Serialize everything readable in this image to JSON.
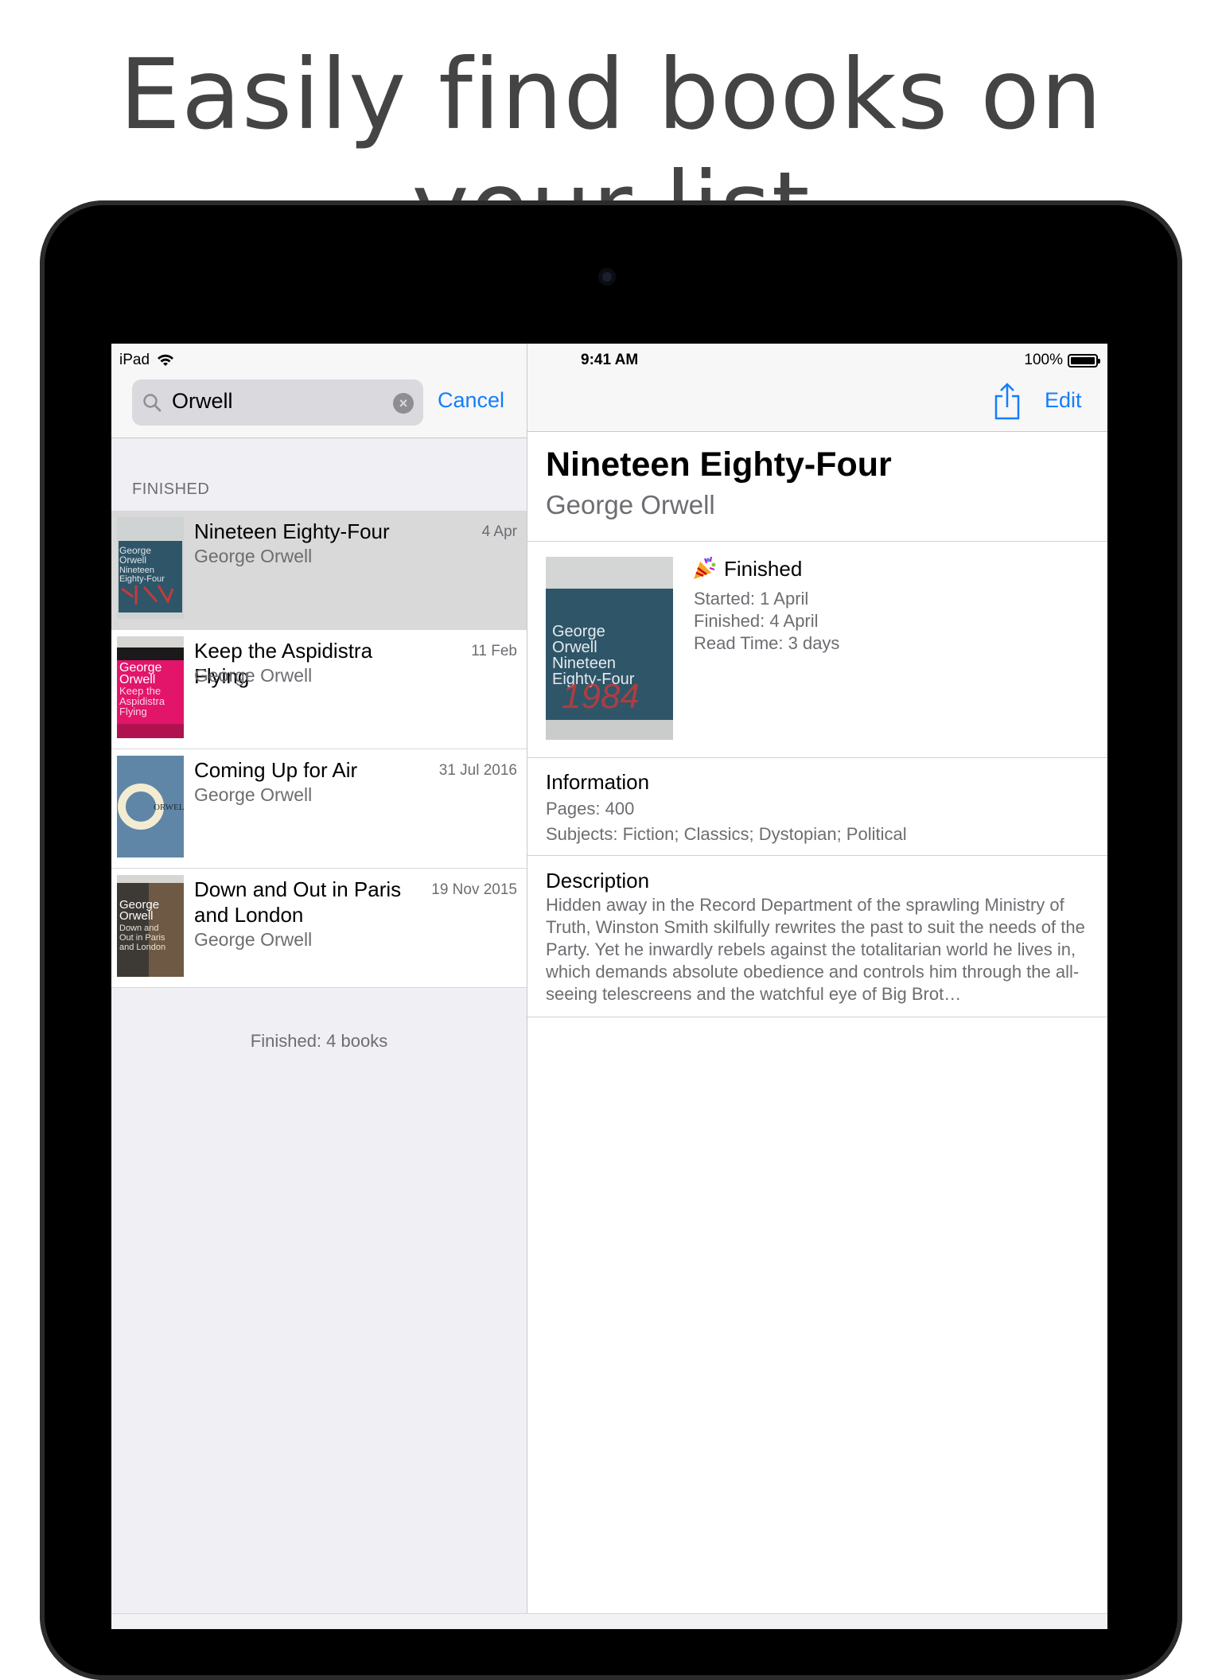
{
  "headline": "Easily find books on your list",
  "status_bar": {
    "device": "iPad",
    "time": "9:41 AM",
    "battery": "100%"
  },
  "search": {
    "value": "Orwell",
    "cancel_label": "Cancel"
  },
  "list": {
    "section_header": "FINISHED",
    "books": [
      {
        "title": "Nineteen Eighty-Four",
        "author": "George Orwell",
        "date": "4 Apr",
        "cover_text": [
          "George",
          "Orwell",
          "Nineteen",
          "Eighty-Four"
        ],
        "cover_colors": {
          "bg": "#2f5568",
          "accent": "#c23b3b"
        }
      },
      {
        "title": "Keep the Aspidistra Flying",
        "author": "George Orwell",
        "date": "11 Feb",
        "cover_text": [
          "George",
          "Orwell",
          "Keep the",
          "Aspidistra",
          "Flying"
        ],
        "cover_colors": {
          "bg": "#e2156a",
          "accent": "#1a1a1a"
        }
      },
      {
        "title": "Coming Up for Air",
        "author": "George Orwell",
        "date": "31 Jul 2016",
        "cover_text": [
          "ORWELL"
        ],
        "cover_colors": {
          "bg": "#5f86a6",
          "accent": "#f3ecd2"
        }
      },
      {
        "title": "Down and Out in Paris and London",
        "author": "George Orwell",
        "date": "19 Nov 2015",
        "cover_text": [
          "George",
          "Orwell",
          "Down and",
          "Out in Paris",
          "and London"
        ],
        "cover_colors": {
          "bg": "#3d3a36",
          "accent": "#8a6f4e"
        }
      }
    ],
    "footer": "Finished: 4 books"
  },
  "toolbar": {
    "edit_label": "Edit",
    "share_icon": "share-icon"
  },
  "detail": {
    "title": "Nineteen Eighty-Four",
    "author": "George Orwell",
    "status_icon": "party-popper-icon",
    "status": "Finished",
    "started": "Started: 1 April",
    "finished": "Finished: 4 April",
    "read_time": "Read Time: 3 days",
    "cover_text": [
      "George",
      "Orwell",
      "Nineteen",
      "Eighty-Four",
      "1984"
    ],
    "information_title": "Information",
    "pages": "Pages: 400",
    "subjects": "Subjects: Fiction; Classics; Dystopian; Political",
    "description_title": "Description",
    "description": "Hidden away in the Record Department of the sprawling Ministry of Truth, Winston Smith skilfully rewrites the past to suit the needs of the Party. Yet he inwardly rebels against the totalitarian world he lives in, which demands absolute obedience and controls him through the all-seeing telescreens and the watchful eye of Big Brot…"
  },
  "colors": {
    "tint": "#147efb",
    "secondary_text": "#6d6d72",
    "grouped_bg": "#efeff4",
    "selected_row": "#d9d9d9"
  }
}
